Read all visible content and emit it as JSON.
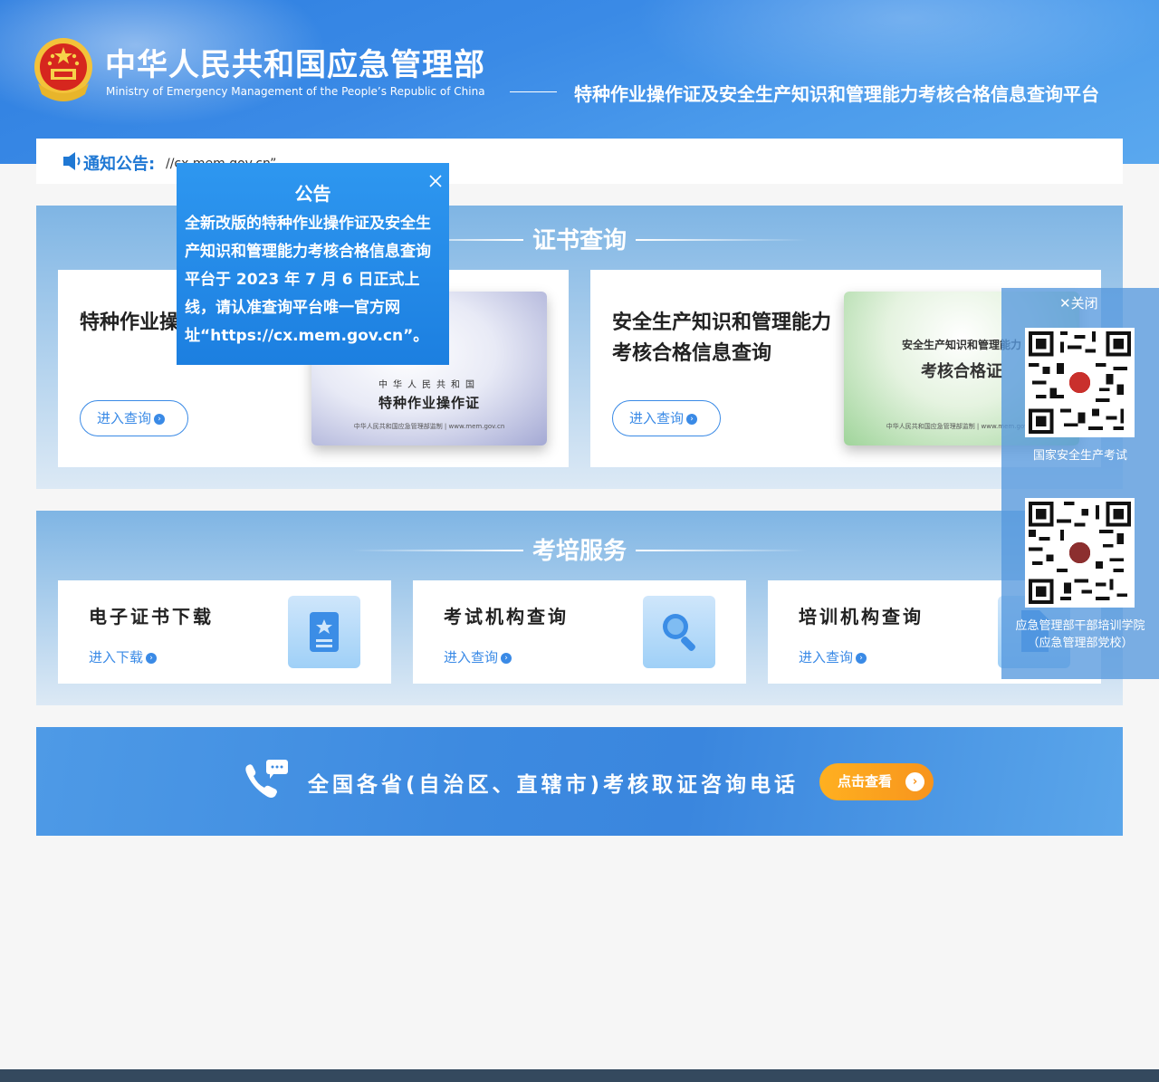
{
  "header": {
    "ministry_cn": "中华人民共和国应急管理部",
    "ministry_en": "Ministry of Emergency Management of the People’s Republic of China",
    "platform_title": "特种作业操作证及安全生产知识和管理能力考核合格信息查询平台"
  },
  "notice": {
    "label": "通知公告:",
    "text": "//cx.mem.gov.cn”。"
  },
  "cert_section": {
    "title": "证书查询",
    "cards": [
      {
        "title_line1": "特种作业操作证查询",
        "title_line2": "",
        "button": "进入查询",
        "image": {
          "country": "中华人民共和国",
          "name": "特种作业操作证",
          "footer": "中华人民共和国应急管理部监制 | www.mem.gov.cn"
        }
      },
      {
        "title_line1": "安全生产知识和管理能力",
        "title_line2": "考核合格信息查询",
        "button": "进入查询",
        "image": {
          "top": "安全生产知识和管理能力",
          "big": "考核合格证",
          "footer": "中华人民共和国应急管理部监制 | www.mem.gov.cn"
        }
      }
    ]
  },
  "train_section": {
    "title": "考培服务",
    "cards": [
      {
        "title": "电子证书下载",
        "link": "进入下载",
        "icon": "certificate-icon"
      },
      {
        "title": "考试机构查询",
        "link": "进入查询",
        "icon": "magnifier-icon"
      },
      {
        "title": "培训机构查询",
        "link": "进入查询",
        "icon": "document-icon"
      }
    ]
  },
  "phone_banner": {
    "text": "全国各省(自治区、直辖市)考核取证咨询电话",
    "button": "点击查看"
  },
  "popup": {
    "title": "公告",
    "body": "全新改版的特种作业操作证及安全生产知识和管理能力考核合格信息查询平台于 2023 年 7 月 6 日正式上线，请认准查询平台唯一官方网址“https://cx.mem.gov.cn”。"
  },
  "qr_panel": {
    "close": "关闭",
    "items": [
      {
        "label_line1": "国家安全生产考试",
        "label_line2": ""
      },
      {
        "label_line1": "应急管理部干部培训学院",
        "label_line2": "（应急管理部党校）"
      }
    ]
  },
  "colors": {
    "brand_blue": "#3a8ae6",
    "accent_orange": "#f7941d",
    "footer": "#34495e"
  }
}
